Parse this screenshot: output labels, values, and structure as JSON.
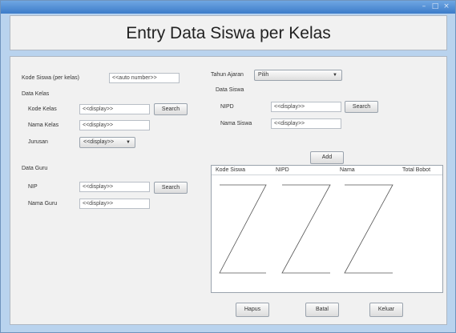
{
  "window": {
    "controls": [
      "–",
      "□",
      "×"
    ]
  },
  "header": {
    "title": "Entry Data Siswa per Kelas"
  },
  "form": {
    "kode_siswa_label": "Kode Siswa (per kelas)",
    "kode_siswa_value": "<<auto number>>",
    "tahun_ajaran_label": "Tahun Ajaran",
    "tahun_ajaran_value": "Pilih",
    "data_kelas": {
      "section_label": "Data Kelas",
      "kode_kelas_label": "Kode Kelas",
      "kode_kelas_value": "<<display>>",
      "search_label": "Search",
      "nama_kelas_label": "Nama Kelas",
      "nama_kelas_value": "<<display>>",
      "jurusan_label": "Jurusan",
      "jurusan_value": "<<display>>"
    },
    "data_guru": {
      "section_label": "Data Guru",
      "nip_label": "NIP",
      "nip_value": "<<display>>",
      "search_label": "Search",
      "nama_guru_label": "Nama Guru",
      "nama_guru_value": "<<display>>"
    },
    "data_siswa": {
      "section_label": "Data Siswa",
      "nipd_label": "NIPD",
      "nipd_value": "<<display>>",
      "search_label": "Search",
      "nama_siswa_label": "Nama Siswa",
      "nama_siswa_value": "<<display>>"
    },
    "add_label": "Add"
  },
  "table": {
    "columns": [
      "Kode Siswa",
      "NIPD",
      "Nama",
      "Total Bobot"
    ]
  },
  "footer": {
    "hapus_label": "Hapus",
    "batal_label": "Batal",
    "keluar_label": "Keluar"
  }
}
